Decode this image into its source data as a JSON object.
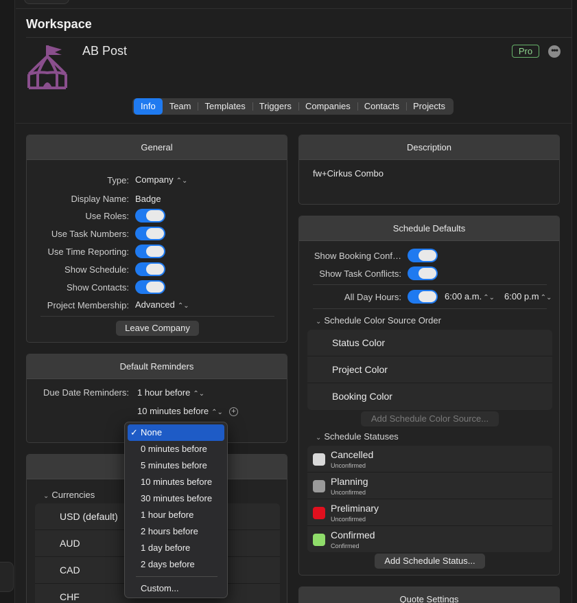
{
  "workspace": {
    "title": "Workspace"
  },
  "company": {
    "name": "AB Post",
    "badge": "Pro",
    "more_icon": "ellipsis-circle-icon",
    "logo_icon": "circus-tent-icon",
    "logo_color": "#8a4f8d"
  },
  "tabs": [
    {
      "label": "Info",
      "active": true
    },
    {
      "label": "Team"
    },
    {
      "label": "Templates"
    },
    {
      "label": "Triggers"
    },
    {
      "label": "Companies"
    },
    {
      "label": "Contacts"
    },
    {
      "label": "Projects"
    }
  ],
  "general": {
    "title": "General",
    "type_label": "Type:",
    "type_value": "Company",
    "display_name_label": "Display Name:",
    "display_name_value": "Badge",
    "use_roles_label": "Use Roles:",
    "use_task_numbers_label": "Use Task Numbers:",
    "use_time_reporting_label": "Use Time Reporting:",
    "show_schedule_label": "Show Schedule:",
    "show_contacts_label": "Show Contacts:",
    "project_membership_label": "Project Membership:",
    "project_membership_value": "Advanced",
    "leave_button": "Leave Company"
  },
  "reminders": {
    "title": "Default Reminders",
    "due_date_label": "Due Date Reminders:",
    "value_1": "1 hour before",
    "value_2": "10 minutes before"
  },
  "currencies": {
    "header": "Currencies",
    "items": [
      "USD (default)",
      "AUD",
      "CAD",
      "CHF"
    ]
  },
  "description": {
    "title": "Description",
    "text": "fw+Cirkus Combo"
  },
  "schedule": {
    "title": "Schedule Defaults",
    "show_booking_conflicts_label": "Show Booking Conf…",
    "show_task_conflicts_label": "Show Task Conflicts:",
    "all_day_hours_label": "All Day Hours:",
    "start_time": "6:00 a.m.",
    "end_time": "6:00 p.m",
    "color_source_header": "Schedule Color Source Order",
    "color_sources": [
      "Status Color",
      "Project Color",
      "Booking Color"
    ],
    "add_color_source": "Add Schedule Color Source...",
    "statuses_header": "Schedule Statuses",
    "statuses": [
      {
        "name": "Cancelled",
        "state": "Unconfirmed",
        "color": "#d9d9d9"
      },
      {
        "name": "Planning",
        "state": "Unconfirmed",
        "color": "#9a9a9a"
      },
      {
        "name": "Preliminary",
        "state": "Unconfirmed",
        "color": "#e0101e"
      },
      {
        "name": "Confirmed",
        "state": "Confirmed",
        "color": "#8fdc6a"
      }
    ],
    "add_status": "Add Schedule Status..."
  },
  "next_panel": {
    "title": "Quote Settings"
  },
  "menu": {
    "items": [
      {
        "label": "None",
        "selected": true
      },
      {
        "label": "0 minutes before"
      },
      {
        "label": "5 minutes before"
      },
      {
        "label": "10 minutes before"
      },
      {
        "label": "30 minutes before"
      },
      {
        "label": "1 hour before"
      },
      {
        "label": "2 hours before"
      },
      {
        "label": "1 day before"
      },
      {
        "label": "2 days before"
      }
    ],
    "custom": "Custom..."
  },
  "colors": {
    "accent": "#1f7af0",
    "menu_selected": "#1e5bc6",
    "pro_green": "#8fd68f"
  }
}
